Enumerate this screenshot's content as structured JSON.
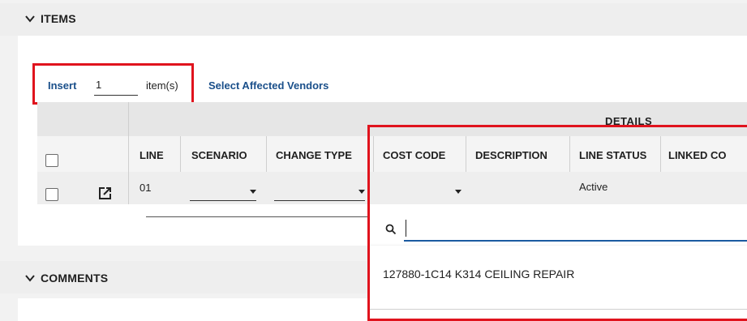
{
  "items_section": {
    "title": "ITEMS"
  },
  "toolbar": {
    "insert_label": "Insert",
    "insert_value": "1",
    "items_suffix": "item(s)",
    "select_vendors_label": "Select Affected Vendors"
  },
  "table": {
    "group_header": "DETAILS",
    "columns": [
      "LINE",
      "SCENARIO",
      "CHANGE TYPE",
      "COST CODE",
      "DESCRIPTION",
      "LINE STATUS",
      "LINKED CO"
    ],
    "row": {
      "line": "01",
      "line_status": "Active"
    }
  },
  "dropdown": {
    "search_value": "",
    "option": "127880-1C14 K314 CEILING REPAIR"
  },
  "comments_section": {
    "title": "COMMENTS"
  },
  "colors": {
    "highlight": "#e0131d",
    "link": "#1a4f8a"
  }
}
